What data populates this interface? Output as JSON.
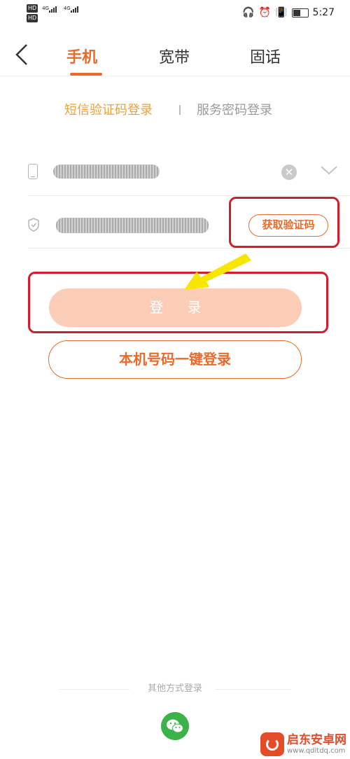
{
  "status_bar": {
    "hd1": "HD",
    "hd2": "HD",
    "net1": "4G",
    "net2": "4G",
    "time": "5:27",
    "battery_level": 0.6
  },
  "header": {
    "tabs": [
      {
        "label": "手机",
        "active": true
      },
      {
        "label": "宽带",
        "active": false
      },
      {
        "label": "固话",
        "active": false
      }
    ]
  },
  "login_modes": {
    "sms": "短信验证码登录",
    "password": "服务密码登录"
  },
  "form": {
    "get_code_label": "获取验证码",
    "login_label": "登 录",
    "one_key_label": "本机号码一键登录"
  },
  "other": {
    "label": "其他方式登录"
  },
  "watermark": {
    "title": "启东安卓网",
    "url": "www.qdltdq.com"
  },
  "colors": {
    "accent": "#e96a2b",
    "login_disabled": "#fbcdb7",
    "highlight": "#d21d2c",
    "arrow": "#f7e600",
    "wechat": "#3bb34a"
  }
}
